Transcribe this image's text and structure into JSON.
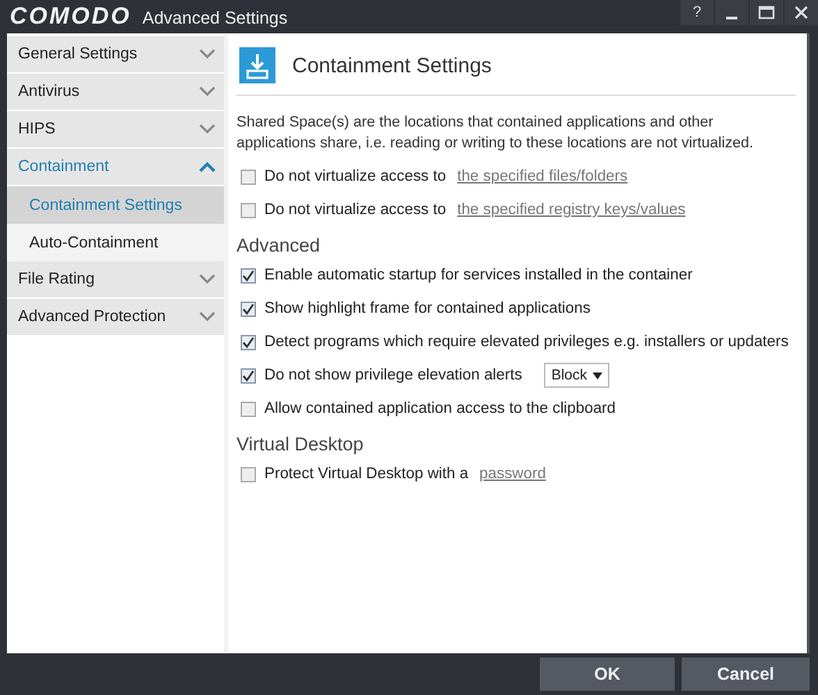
{
  "window": {
    "logo": "COMODO",
    "title": "Advanced Settings",
    "help": "?"
  },
  "sidebar": {
    "items": [
      {
        "label": "General Settings",
        "expanded": false
      },
      {
        "label": "Antivirus",
        "expanded": false
      },
      {
        "label": "HIPS",
        "expanded": false
      },
      {
        "label": "Containment",
        "expanded": true,
        "children": [
          {
            "label": "Containment Settings",
            "selected": true
          },
          {
            "label": "Auto-Containment",
            "selected": false
          }
        ]
      },
      {
        "label": "File Rating",
        "expanded": false
      },
      {
        "label": "Advanced Protection",
        "expanded": false
      }
    ]
  },
  "content": {
    "title": "Containment Settings",
    "description": "Shared Space(s) are the locations that contained applications and other applications share, i.e. reading or writing to these locations are not virtualized.",
    "sections": [
      {
        "options": [
          {
            "kind": "link",
            "label": "Do not virtualize access to",
            "link": "the specified files/folders",
            "checked": false
          },
          {
            "kind": "link",
            "label": "Do not virtualize access to",
            "link": "the specified registry keys/values",
            "checked": false
          }
        ]
      },
      {
        "heading": "Advanced",
        "options": [
          {
            "kind": "plain",
            "label": "Enable automatic startup for services installed in the container",
            "checked": true
          },
          {
            "kind": "plain",
            "label": "Show highlight frame for contained applications",
            "checked": true
          },
          {
            "kind": "plain",
            "label": "Detect programs which require elevated privileges e.g. installers or updaters",
            "checked": true
          },
          {
            "kind": "dropdown",
            "label": "Do not show privilege elevation alerts",
            "value": "Block",
            "checked": true
          },
          {
            "kind": "plain",
            "label": "Allow contained application access to the clipboard",
            "checked": false
          }
        ]
      },
      {
        "heading": "Virtual Desktop",
        "options": [
          {
            "kind": "link",
            "label": "Protect Virtual Desktop with a",
            "link": "password",
            "checked": false
          }
        ]
      }
    ]
  },
  "buttons": [
    "OK",
    "Cancel"
  ]
}
